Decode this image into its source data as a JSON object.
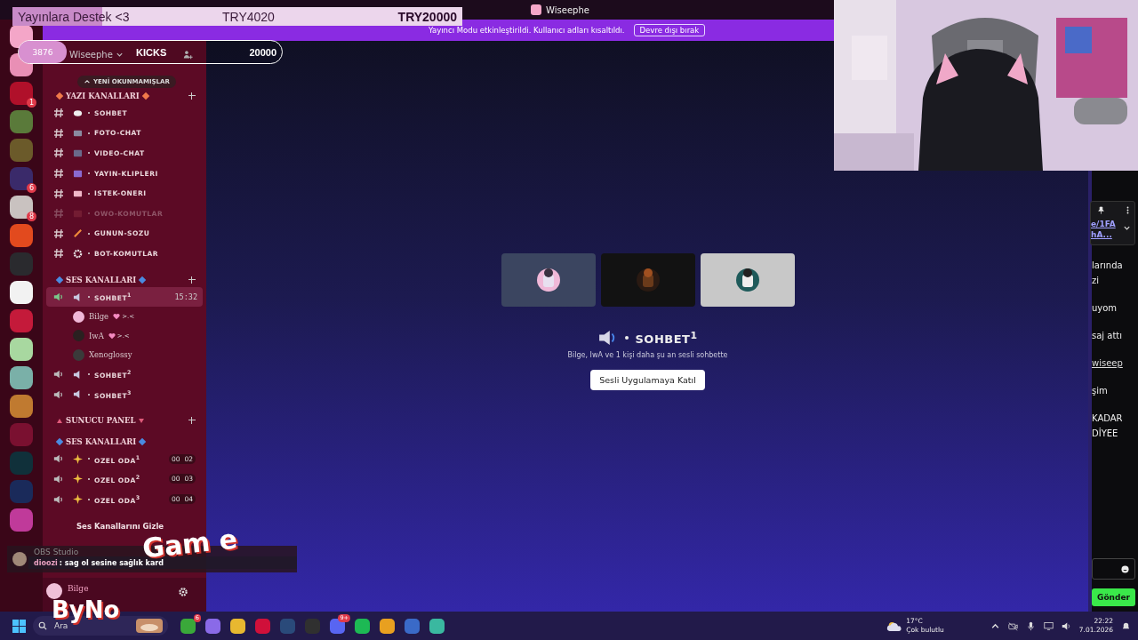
{
  "window": {
    "title": "Wiseephe"
  },
  "donation_bar": {
    "label": "Yayınlara Destek <3",
    "amount": "TRY4020",
    "goal": "TRY20000",
    "level": 0.2
  },
  "kicks_counter": {
    "count": "3876",
    "label": "KICKS",
    "goal": "20000"
  },
  "banner": {
    "text": "Yayıncı Modu etkinleştirildi. Kullanıcı adları kısaltıldı.",
    "button": "Devre dışı bırak"
  },
  "servers": [
    {
      "color": "#f4a6c8"
    },
    {
      "color": "#e98fb5"
    },
    {
      "color": "#b0102a",
      "badge": "1"
    },
    {
      "color": "#5a7a3a"
    },
    {
      "color": "#6b5a2a"
    },
    {
      "color": "#3a2a6a",
      "badge": "6"
    },
    {
      "color": "#c9c2c0",
      "badge": "8"
    },
    {
      "color": "#e24a1e"
    },
    {
      "color": "#2a2a2e"
    },
    {
      "color": "#f2f2f2"
    },
    {
      "color": "#c41a3a"
    },
    {
      "color": "#a8d8a0"
    },
    {
      "color": "#7ab0a8"
    },
    {
      "color": "#c07a30"
    },
    {
      "color": "#7a1030"
    },
    {
      "color": "#10303a"
    },
    {
      "color": "#1a2a5a"
    },
    {
      "color": "#c03a9a"
    }
  ],
  "sidebar": {
    "server_name": "Wiseephe",
    "new_unread": "YENİ OKUNMAMIŞLAR",
    "text_section": "YAZI KANALLARI",
    "text_channels": [
      {
        "name": "SOHBET",
        "kind": "speech",
        "muted": false
      },
      {
        "name": "FOTO-CHAT",
        "muted": false
      },
      {
        "name": "VIDEO-CHAT",
        "kind": "video",
        "muted": false
      },
      {
        "name": "YAYIN-KLIPLERI",
        "kind": "clapper",
        "muted": false
      },
      {
        "name": "ISTEK-ONERI",
        "kind": "inbox",
        "muted": false
      },
      {
        "name": "OWO-KOMUTLAR",
        "kind": "grid",
        "muted": true
      },
      {
        "name": "GUNUN-SOZU",
        "kind": "pencil",
        "muted": false
      },
      {
        "name": "BOT-KOMUTLAR",
        "kind": "gear",
        "muted": false
      }
    ],
    "voice_section": "SES KANALLARI",
    "voice_channels": [
      {
        "name": "SOHBET$^{1}$",
        "selected": true,
        "time": "15:32",
        "members": [
          {
            "name": "Bilge",
            "tag": ">.<",
            "color": "#f0b8d8"
          },
          {
            "name": "IwA",
            "tag": ">.<",
            "color": "#2a2020"
          },
          {
            "name": "Xenoglossy",
            "color": "#3a3a3a"
          }
        ]
      },
      {
        "name": "SOHBET$^{2}$",
        "selected": false
      },
      {
        "name": "SOHBET$^{3}$",
        "selected": false
      }
    ],
    "panel_section": "SUNUCU PANEL",
    "room_section": "SES KANALLARI",
    "rooms": [
      {
        "name": "OZEL ODA$^{1}$",
        "counter": [
          "00",
          "02"
        ]
      },
      {
        "name": "OZEL ODA$^{2}$",
        "counter": [
          "00",
          "03"
        ]
      },
      {
        "name": "OZEL ODA$^{3}$",
        "counter": [
          "00",
          "04"
        ]
      }
    ],
    "hide_voice": "Ses Kanallarını Gizle",
    "user": {
      "name": "Bilge"
    }
  },
  "obs_chat": {
    "app": "OBS Studio",
    "user": "dioozi",
    "message": ": sag ol sesine sağlık kard"
  },
  "logo": {
    "top": "Gam e",
    "bottom": "ByNo"
  },
  "voice_view": {
    "title": "SOHBET$^{1}$",
    "subtitle": "Bilge, IwA ve 1 kişi daha şu an sesli sohbette",
    "button": "Sesli Uygulamaya Katıl"
  },
  "chat": {
    "pinned": [
      "e/1FA",
      "hA..."
    ],
    "messages": [
      {
        "lines": [
          "larında",
          "zi"
        ]
      },
      {
        "lines": [
          "uyom"
        ]
      },
      {
        "lines": [
          "saj attı"
        ]
      },
      {
        "lines": [
          "wiseep"
        ],
        "link": true
      },
      {
        "lines": [
          "şim"
        ]
      },
      {
        "lines": [
          "KADAR",
          "DİYEE"
        ]
      }
    ],
    "send": "Gönder"
  },
  "taskbar": {
    "search": "Ara",
    "apps": [
      {
        "color": "#3aa83a",
        "badge": "6"
      },
      {
        "color": "#8a6ae8"
      },
      {
        "color": "#e8b830"
      },
      {
        "color": "#d0103a"
      },
      {
        "color": "#2a4a7a"
      },
      {
        "color": "#303030"
      },
      {
        "color": "#5865f2",
        "badge": "9+"
      },
      {
        "color": "#1db954"
      },
      {
        "color": "#e8a020"
      },
      {
        "color": "#3a6ac8"
      },
      {
        "color": "#3ab8a0"
      }
    ],
    "temperature": "17°C",
    "weather": "Çok bulutlu",
    "time": "22:22",
    "date": "7.01.2026"
  }
}
